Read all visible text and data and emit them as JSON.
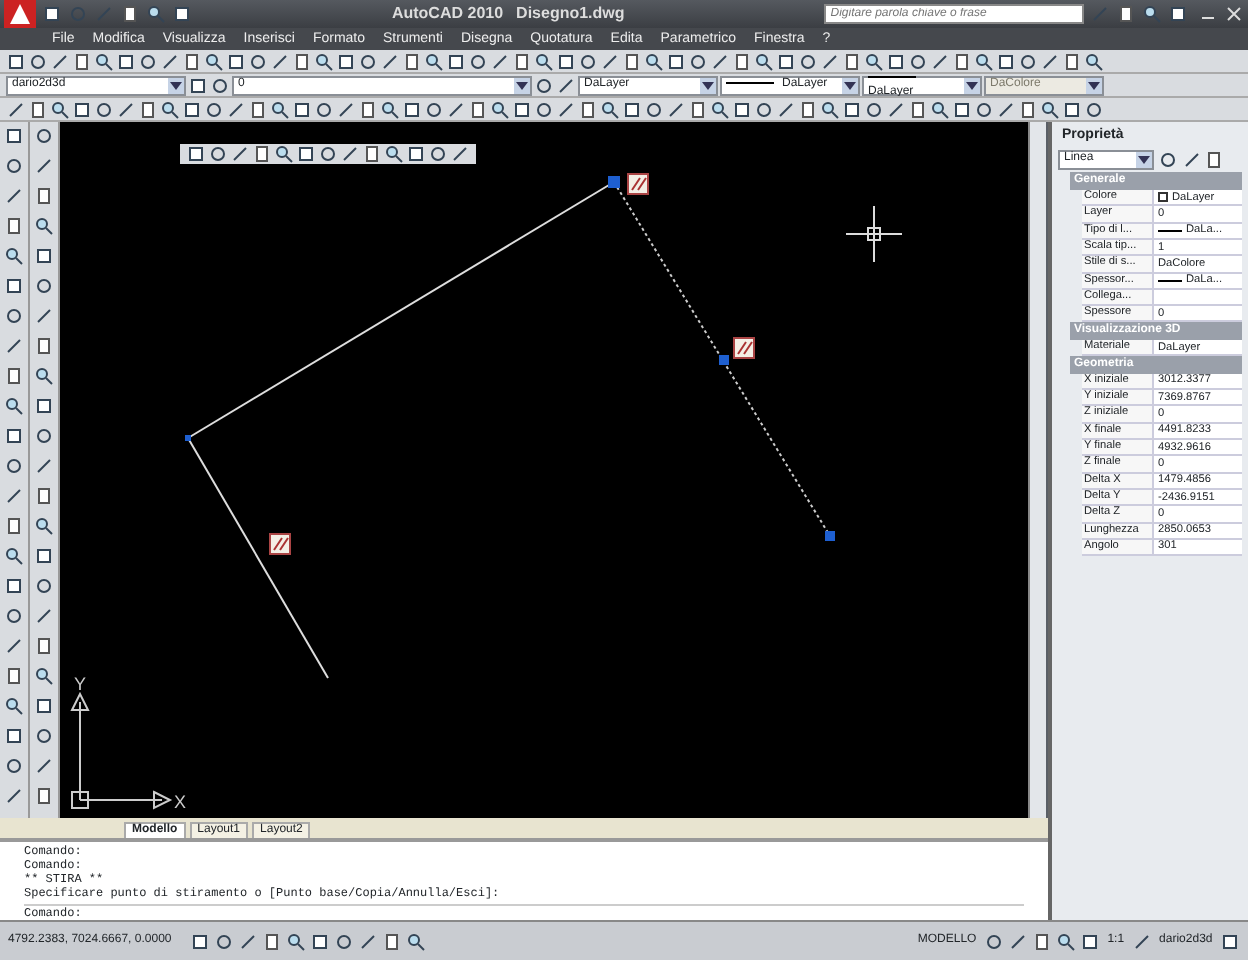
{
  "window": {
    "title": "AutoCAD 2010",
    "document": "Disegno1.dwg",
    "search": {
      "placeholder": "Digitare parola chiave o frase"
    }
  },
  "menu": [
    "File",
    "Modifica",
    "Visualizza",
    "Inserisci",
    "Formato",
    "Strumenti",
    "Disegna",
    "Quotatura",
    "Edita",
    "Parametrico",
    "Finestra",
    "?"
  ],
  "toolbar_combos": [
    {
      "kind": "workspace",
      "value": "dario2d3d",
      "disabled": false
    },
    {
      "kind": "layer",
      "value": "0",
      "disabled": false
    },
    {
      "kind": "color",
      "value": "DaLayer",
      "disabled": false
    },
    {
      "kind": "linetype",
      "value": "DaLayer",
      "disabled": false
    },
    {
      "kind": "lineweight",
      "value": "DaLayer",
      "disabled": false
    },
    {
      "kind": "plotstyle",
      "value": "DaColore",
      "disabled": true
    }
  ],
  "drawing": {
    "ucs": {
      "x_label": "X",
      "y_label": "Y"
    }
  },
  "layout_tabs": [
    {
      "label": "Modello",
      "selected": true
    },
    {
      "label": "Layout1",
      "selected": false
    },
    {
      "label": "Layout2",
      "selected": false
    }
  ],
  "command_history": [
    "Comando:",
    "Comando:",
    "** STIRA **",
    "Specificare punto di stiramento o [Punto base/Copia/Annulla/Esci]:"
  ],
  "command_prompt": "Comando:",
  "status_bar": {
    "coordinates": "4792.2383, 7024.6667, 0.0000",
    "space": "MODELLO",
    "scale": "1:1",
    "workspace": "dario2d3d"
  },
  "properties": {
    "title": "Proprietà",
    "object_type": "Linea",
    "sections": [
      {
        "title": "Generale",
        "rows": [
          {
            "label": "Colore",
            "value": "DaLayer",
            "kind": "color"
          },
          {
            "label": "Layer",
            "value": "0",
            "kind": "text"
          },
          {
            "label": "Tipo di l...",
            "value": "DaLa...",
            "kind": "line"
          },
          {
            "label": "Scala tip...",
            "value": "1",
            "kind": "text"
          },
          {
            "label": "Stile di s...",
            "value": "DaColore",
            "kind": "text"
          },
          {
            "label": "Spessor...",
            "value": "DaLa...",
            "kind": "line"
          },
          {
            "label": "Collega...",
            "kind": "text"
          },
          {
            "label": "Spessore",
            "value": "0",
            "kind": "text"
          }
        ]
      },
      {
        "title": "Visualizzazione 3D",
        "rows": [
          {
            "label": "Materiale",
            "value": "DaLayer",
            "kind": "text"
          }
        ]
      },
      {
        "title": "Geometria",
        "rows": [
          {
            "label": "X iniziale",
            "value": "3012.3377",
            "kind": "text"
          },
          {
            "label": "Y iniziale",
            "value": "7369.8767",
            "kind": "text"
          },
          {
            "label": "Z iniziale",
            "value": "0",
            "kind": "text"
          },
          {
            "label": "X finale",
            "value": "4491.8233",
            "kind": "text"
          },
          {
            "label": "Y finale",
            "value": "4932.9616",
            "kind": "text"
          },
          {
            "label": "Z finale",
            "value": "0",
            "kind": "text"
          },
          {
            "label": "Delta X",
            "value": "1479.4856",
            "kind": "text"
          },
          {
            "label": "Delta Y",
            "value": "-2436.9151",
            "kind": "text"
          },
          {
            "label": "Delta Z",
            "value": "0",
            "kind": "text"
          },
          {
            "label": "Lunghezza",
            "value": "2850.0653",
            "kind": "text"
          },
          {
            "label": "Angolo",
            "value": "301",
            "kind": "text"
          }
        ]
      }
    ]
  }
}
